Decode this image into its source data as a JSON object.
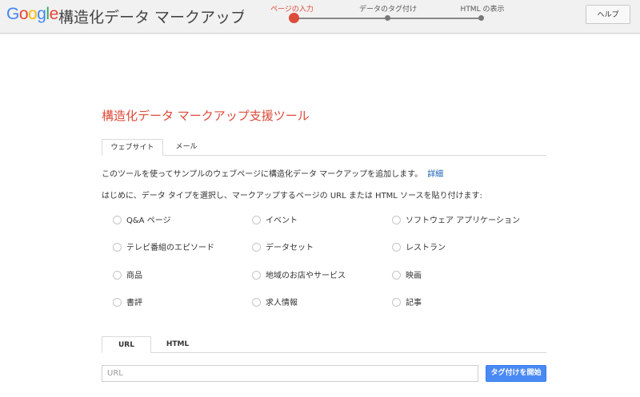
{
  "header": {
    "logo_letters": [
      {
        "ch": "G",
        "color": "#4285F4"
      },
      {
        "ch": "o",
        "color": "#EA4335"
      },
      {
        "ch": "o",
        "color": "#FBBC05"
      },
      {
        "ch": "g",
        "color": "#4285F4"
      },
      {
        "ch": "l",
        "color": "#34A853"
      },
      {
        "ch": "e",
        "color": "#EA4335"
      }
    ],
    "app_name": "構造化データ マークアップ支援ツール",
    "steps": [
      {
        "label": "ページの入力",
        "active": true
      },
      {
        "label": "データのタグ付け",
        "active": false
      },
      {
        "label": "HTML の表示",
        "active": false
      }
    ],
    "help_label": "ヘルプ"
  },
  "main": {
    "title": "構造化データ マークアップ支援ツール",
    "source_tabs": [
      {
        "label": "ウェブサイト",
        "active": true
      },
      {
        "label": "メール",
        "active": false
      }
    ],
    "intro_text": "このツールを使ってサンプルのウェブページに構造化データ マークアップを追加します。",
    "details_link": "詳細",
    "instruction_text": "はじめに、データ タイプを選択し、マークアップするページの URL または HTML ソースを貼り付けます:",
    "data_types": [
      [
        "Q&A ページ",
        "イベント",
        "ソフトウェア アプリケーション"
      ],
      [
        "テレビ番組のエピソード",
        "データセット",
        "レストラン"
      ],
      [
        "商品",
        "地域のお店やサービス",
        "映画"
      ],
      [
        "書評",
        "求人情報",
        "記事"
      ]
    ],
    "input_tabs": [
      {
        "label": "URL",
        "active": true
      },
      {
        "label": "HTML",
        "active": false
      }
    ],
    "url_placeholder": "URL",
    "start_button_label": "タグ付けを開始"
  },
  "colors": {
    "accent_red": "#dd4b39",
    "button_blue": "#4a8af4",
    "link_blue": "#1a5fb4"
  }
}
